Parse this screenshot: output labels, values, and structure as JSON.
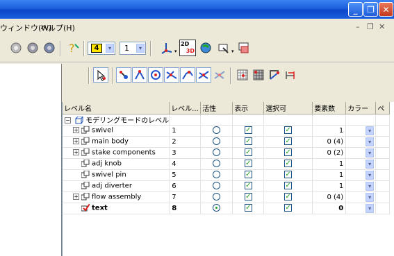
{
  "menu": {
    "window": "ウィンドウ(W)",
    "help": "ヘルプ(H)"
  },
  "toolbar": {
    "layer_number": "4",
    "line_weight": "1"
  },
  "table": {
    "headers": [
      "レベル名",
      "レベル...",
      "活性",
      "表示",
      "選択可",
      "要素数",
      "カラー",
      "ペ"
    ],
    "root": "モデリングモードのレベル",
    "rows": [
      {
        "name": "swivel",
        "level": "1",
        "count": "1",
        "expandable": true,
        "active": false
      },
      {
        "name": "main body",
        "level": "2",
        "count": "0 (4)",
        "expandable": true,
        "active": false
      },
      {
        "name": "stake components",
        "level": "3",
        "count": "0 (2)",
        "expandable": true,
        "active": false
      },
      {
        "name": "adj knob",
        "level": "4",
        "count": "1",
        "expandable": false,
        "active": false
      },
      {
        "name": "swivel pin",
        "level": "5",
        "count": "1",
        "expandable": false,
        "active": false
      },
      {
        "name": "adj diverter",
        "level": "6",
        "count": "1",
        "expandable": false,
        "active": false
      },
      {
        "name": "flow assembly",
        "level": "7",
        "count": "0 (4)",
        "expandable": true,
        "active": false
      },
      {
        "name": "text",
        "level": "8",
        "count": "0",
        "expandable": false,
        "active": true
      }
    ]
  }
}
